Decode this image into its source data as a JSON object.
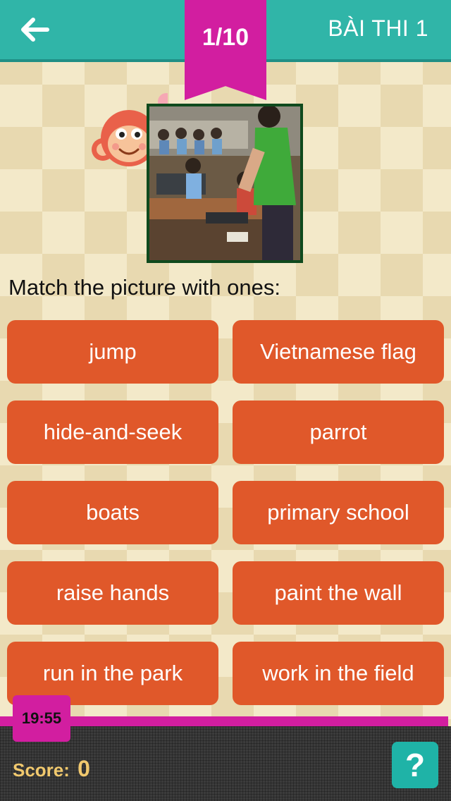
{
  "header": {
    "title": "BÀI THI 1",
    "back_icon": "arrow-left-icon",
    "color": "#30b5a8"
  },
  "progress": {
    "label": "1/10",
    "color": "#d21ea0"
  },
  "question": {
    "prompt": "Match the picture with ones:"
  },
  "answers": [
    "jump",
    "Vietnamese flag",
    "hide-and-seek",
    "parrot",
    "boats",
    "primary school",
    "raise hands",
    "paint the wall",
    "run in the park",
    "work in the field"
  ],
  "footer": {
    "timer": "19:55",
    "score_label": "Score:",
    "score_value": "0",
    "help_label": "?"
  },
  "colors": {
    "answer_button": "#e0582a",
    "accent": "#d21ea0",
    "score_text": "#f1c96e"
  }
}
